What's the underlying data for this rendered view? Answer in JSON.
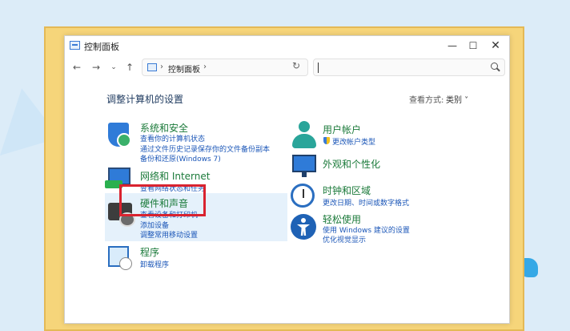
{
  "window": {
    "title": "控制面板",
    "controls": {
      "minimize": "—",
      "maximize": "☐",
      "close": "✕"
    }
  },
  "navbar": {
    "back": "←",
    "forward": "→",
    "recent": "⌄",
    "up": "↑",
    "address_sep": "›",
    "address_text": "控制面板",
    "address_sep2": "›",
    "address_dropdown": "⌄",
    "refresh": "↻",
    "search_placeholder": ""
  },
  "main": {
    "heading": "调整计算机的设置",
    "view_by_label": "查看方式:",
    "view_by_value": "类别 ˅"
  },
  "categories_left": [
    {
      "title": "系统和安全",
      "links": [
        "查看你的计算机状态",
        "通过文件历史记录保存你的文件备份副本",
        "备份和还原(Windows 7)"
      ]
    },
    {
      "title": "网络和 Internet",
      "links": [
        "查看网络状态和任务"
      ]
    },
    {
      "title": "硬件和声音",
      "links": [
        "查看设备和打印机",
        "添加设备",
        "调整常用移动设置"
      ]
    },
    {
      "title": "程序",
      "links": [
        "卸载程序"
      ]
    }
  ],
  "categories_right": [
    {
      "title": "用户帐户",
      "links": [
        "更改帐户类型"
      ]
    },
    {
      "title": "外观和个性化",
      "links": []
    },
    {
      "title": "时钟和区域",
      "links": [
        "更改日期、时间或数字格式"
      ]
    },
    {
      "title": "轻松使用",
      "links": [
        "使用 Windows 建议的设置",
        "优化视觉显示"
      ]
    }
  ],
  "colors": {
    "category_title": "#1b7a3a",
    "link": "#1c57b8",
    "highlight_box": "#d9232f",
    "hover_bg": "#e5f1fb"
  }
}
